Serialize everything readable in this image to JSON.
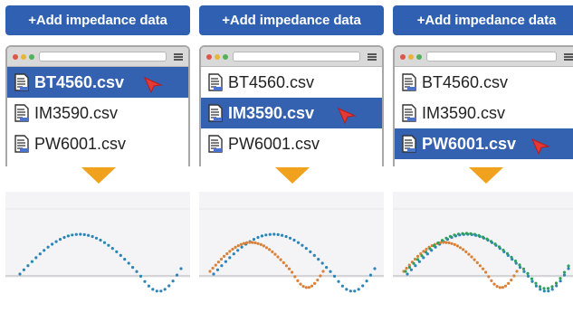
{
  "panels": [
    {
      "add_button": "Add impedance data",
      "files": [
        "BT4560.csv",
        "IM3590.csv",
        "PW6001.csv"
      ],
      "selected_index": 0,
      "plot_series": [
        "blue"
      ]
    },
    {
      "add_button": "Add impedance data",
      "files": [
        "BT4560.csv",
        "IM3590.csv",
        "PW6001.csv"
      ],
      "selected_index": 1,
      "plot_series": [
        "blue",
        "orange"
      ]
    },
    {
      "add_button": "Add impedance data",
      "files": [
        "BT4560.csv",
        "IM3590.csv",
        "PW6001.csv"
      ],
      "selected_index": 2,
      "plot_series": [
        "blue",
        "orange",
        "green"
      ]
    }
  ],
  "colors": {
    "button": "#2f60b2",
    "selection": "#3561b1",
    "arrow": "#f0a11e",
    "cursor": "#e53935",
    "series_blue": "#2c84b8",
    "series_orange": "#d9823a",
    "series_green": "#2fa05a"
  }
}
